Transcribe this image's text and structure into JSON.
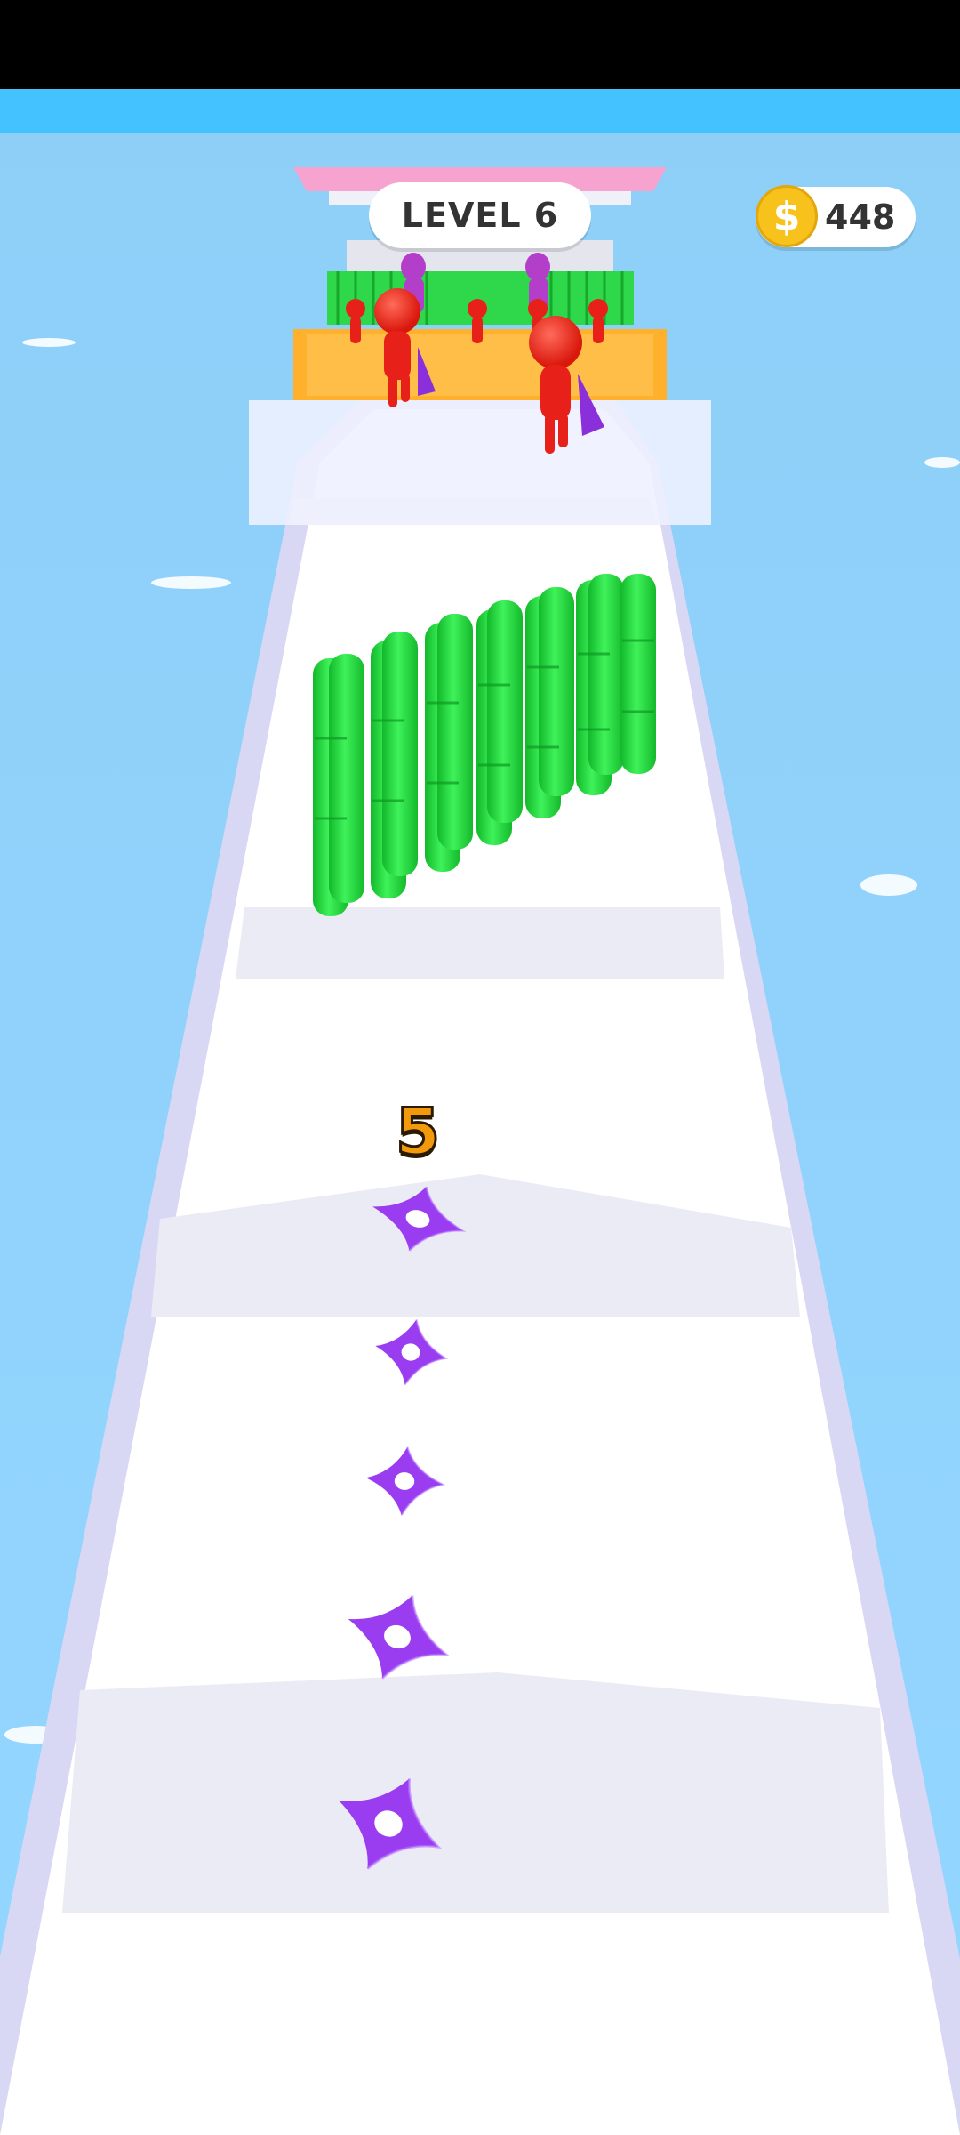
{
  "hud": {
    "level_label": "LEVEL 6",
    "coin_symbol": "$",
    "coins": "448"
  },
  "player": {
    "shuriken_count": "5"
  },
  "colors": {
    "sky": "#8fd3fb",
    "track": "#ffffff",
    "track_rail": "#dcdcf5",
    "bamboo": "#22d33a",
    "shuriken": "#9a3df0",
    "enemy": "#f22a1e",
    "coin": "#f6c21b",
    "platform_orange": "#ffb12e",
    "roof_pink": "#f7a3d0"
  },
  "icons": {
    "coin": "dollar-coin-icon",
    "shuriken": "shuriken-icon"
  }
}
